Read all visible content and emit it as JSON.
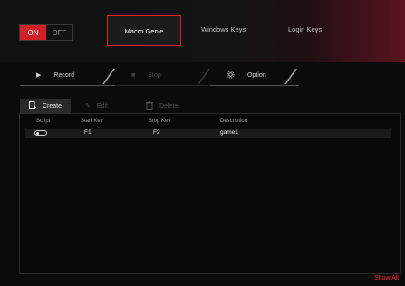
{
  "header": {
    "toggle": {
      "on_label": "ON",
      "off_label": "OFF"
    },
    "tabs": [
      {
        "label": "Macro Genie",
        "active": true
      },
      {
        "label": "Windows Keys",
        "active": false
      },
      {
        "label": "Login Keys",
        "active": false
      }
    ]
  },
  "controls": {
    "record": "Record",
    "stop": "Stop",
    "option": "Option"
  },
  "toolbar": {
    "create": "Create",
    "edit": "Edit",
    "delete": "Delete"
  },
  "table": {
    "columns": [
      "Script",
      "Start Key",
      "Stop Key",
      "Description"
    ],
    "rows": [
      {
        "script_enabled": false,
        "start_key": "F1",
        "stop_key": "F2",
        "description": "game1"
      }
    ]
  },
  "footer": {
    "show_all": "Show All"
  },
  "colors": {
    "accent": "#e0202a"
  }
}
